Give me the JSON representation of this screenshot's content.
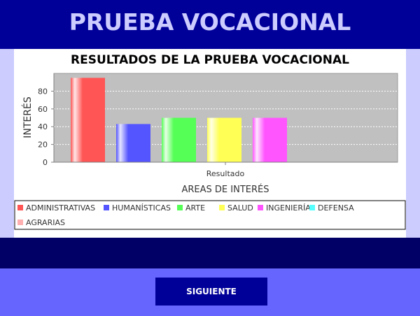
{
  "header": {
    "title": "PRUEBA VOCACIONAL"
  },
  "footer": {
    "next_label": "SIGUIENTE"
  },
  "colors": {
    "header_bg": "#000099",
    "title_text": "#ccccff",
    "panel_side": "#ccccff",
    "bottom_band": "#000066",
    "page_bg": "#6666ff",
    "plot_bg": "#c0c0c0"
  },
  "chart_data": {
    "type": "bar",
    "title": "RESULTADOS DE LA PRUEBA VOCACIONAL",
    "xlabel": "AREAS DE INTERÉS",
    "ylabel": "INTERÉS",
    "categories": [
      "Resultado"
    ],
    "ylim": [
      0,
      100
    ],
    "yticks": [
      0,
      20,
      40,
      60,
      80
    ],
    "grid": true,
    "legend_position": "bottom",
    "series": [
      {
        "name": "ADMINISTRATIVAS",
        "values": [
          95
        ],
        "color": "#ff5555"
      },
      {
        "name": "HUMANÍSTICAS",
        "values": [
          43
        ],
        "color": "#5555ff"
      },
      {
        "name": "ARTE",
        "values": [
          50
        ],
        "color": "#55ff55"
      },
      {
        "name": "SALUD",
        "values": [
          50
        ],
        "color": "#ffff55"
      },
      {
        "name": "INGENIERÍA",
        "values": [
          50
        ],
        "color": "#ff55ff"
      },
      {
        "name": "DEFENSA",
        "values": [
          0
        ],
        "color": "#55ffff"
      },
      {
        "name": "AGRARIAS",
        "values": [
          0
        ],
        "color": "#ffafaf"
      }
    ]
  }
}
